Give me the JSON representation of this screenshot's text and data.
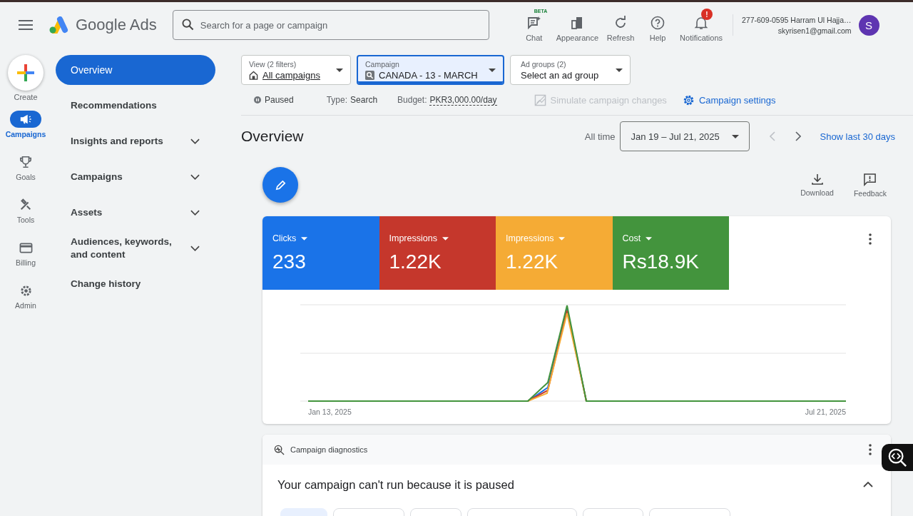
{
  "header": {
    "logo_text": "Google Ads",
    "search": {
      "placeholder": "Search for a page or campaign"
    },
    "tools": [
      {
        "label": "Chat",
        "badge": "BETA"
      },
      {
        "label": "Appearance"
      },
      {
        "label": "Refresh"
      },
      {
        "label": "Help"
      },
      {
        "label": "Notifications",
        "alert": "!"
      }
    ],
    "account": {
      "name": "277-609-0595 Harram Ul Hajja…",
      "email": "skyrisen1@gmail.com",
      "avatar": "S"
    }
  },
  "create": {
    "label": "Create"
  },
  "rail": [
    {
      "label": "Campaigns",
      "selected": true
    },
    {
      "label": "Goals",
      "selected": false
    },
    {
      "label": "Tools",
      "selected": false
    },
    {
      "label": "Billing",
      "selected": false
    },
    {
      "label": "Admin",
      "selected": false
    }
  ],
  "nav": [
    {
      "label": "Overview",
      "kind": "link",
      "selected": true
    },
    {
      "label": "Recommendations",
      "kind": "link",
      "selected": false
    },
    {
      "label": "Insights and reports",
      "kind": "section",
      "selected": false,
      "expanded": false
    },
    {
      "label": "Campaigns",
      "kind": "section",
      "selected": false,
      "expanded": false
    },
    {
      "label": "Assets",
      "kind": "section",
      "selected": false,
      "expanded": false
    },
    {
      "label": "Audiences, keywords, and content",
      "kind": "section",
      "selected": false,
      "expanded": false
    },
    {
      "label": "Change history",
      "kind": "link",
      "selected": false
    }
  ],
  "filters": [
    {
      "label": "View (2 filters)",
      "value": "All campaigns",
      "selected": false
    },
    {
      "label": "Campaign",
      "value": "CANADA - 13 - MARCH",
      "selected": true
    },
    {
      "label": "Ad groups (2)",
      "value": "Select an ad group",
      "selected": false
    }
  ],
  "status": {
    "state": "Paused",
    "type_label": "Type:",
    "type": "Search",
    "budget_label": "Budget:",
    "budget": "PKR3,000.00/day"
  },
  "actions": [
    {
      "label": "Simulate campaign changes",
      "disabled": true
    },
    {
      "label": "Campaign settings",
      "disabled": false
    }
  ],
  "page_title": "Overview",
  "date": {
    "range_label": "All time",
    "range": "Jan 19 – Jul 21, 2025",
    "prev_disabled": true,
    "next_disabled": false,
    "link": "Show last 30 days"
  },
  "page_actions": [
    {
      "label": "Download"
    },
    {
      "label": "Feedback"
    }
  ],
  "metrics": [
    {
      "label": "Clicks",
      "value": "233",
      "color": "#1a73e8"
    },
    {
      "label": "Impressions",
      "value": "1.22K",
      "color": "#c5372c"
    },
    {
      "label": "Impressions",
      "value": "1.22K",
      "color": "#f5ab35"
    },
    {
      "label": "Cost",
      "value": "Rs18.9K",
      "color": "#43943d"
    }
  ],
  "chart": {
    "x_start": "Jan 13, 2025",
    "x_end": "Jul 21, 2025"
  },
  "diagnostics": {
    "title": "Campaign diagnostics",
    "message": "Your campaign can't run because it is paused",
    "expanded": true,
    "chips": [
      {
        "selected": true
      },
      {
        "selected": false
      },
      {
        "selected": false
      },
      {
        "selected": false
      },
      {
        "selected": false
      },
      {
        "selected": false
      }
    ]
  }
}
